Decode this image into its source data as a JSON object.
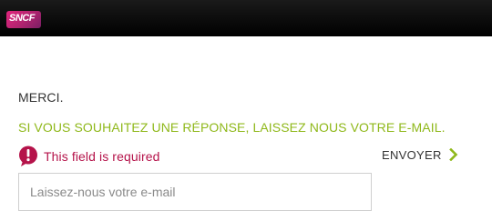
{
  "header": {
    "logo_text": "SNCF",
    "logo_icon": "sncf-logo",
    "background_color": "#000000",
    "logo_color": "#c8246f"
  },
  "feedback": {
    "thanks_text": "MERCI.",
    "prompt_text": "SI VOUS SOUHAITEZ UNE RÉPONSE, LAISSEZ NOUS VOTRE E-MAIL.",
    "prompt_color": "#8fb81a",
    "error_icon": "exclamation-bubble-icon",
    "error_text": "This field is required",
    "error_color": "#b5134a",
    "send_label": "ENVOYER",
    "send_icon": "chevron-right-icon",
    "email_value": "",
    "email_placeholder": "Laissez-nous votre e-mail"
  }
}
